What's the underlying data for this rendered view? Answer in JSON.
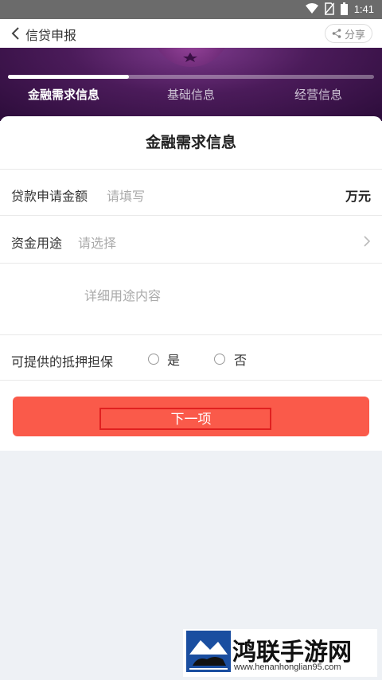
{
  "status_bar": {
    "time": "1:41",
    "icons": [
      "wifi-icon",
      "no-sim-icon",
      "battery-icon"
    ]
  },
  "navbar": {
    "title": "信贷申报",
    "share_label": "分享"
  },
  "progress": {
    "fraction": 0.33
  },
  "steps": [
    {
      "label": "金融需求信息",
      "active": true
    },
    {
      "label": "基础信息",
      "active": false
    },
    {
      "label": "经营信息",
      "active": false
    }
  ],
  "form": {
    "title": "金融需求信息",
    "loan_amount": {
      "label": "贷款申请金额",
      "placeholder": "请填写",
      "unit": "万元"
    },
    "fund_use": {
      "label": "资金用途",
      "placeholder": "请选择"
    },
    "detail": {
      "placeholder": "详细用途内容"
    },
    "collateral": {
      "label": "可提供的抵押担保",
      "options": [
        "是",
        "否"
      ]
    },
    "next_label": "下一项"
  },
  "watermark": {
    "name": "鸿联手游网",
    "url": "www.henanhonglian95.com"
  },
  "colors": {
    "accent": "#fa5a4a",
    "banner": "#4b1b5a"
  }
}
